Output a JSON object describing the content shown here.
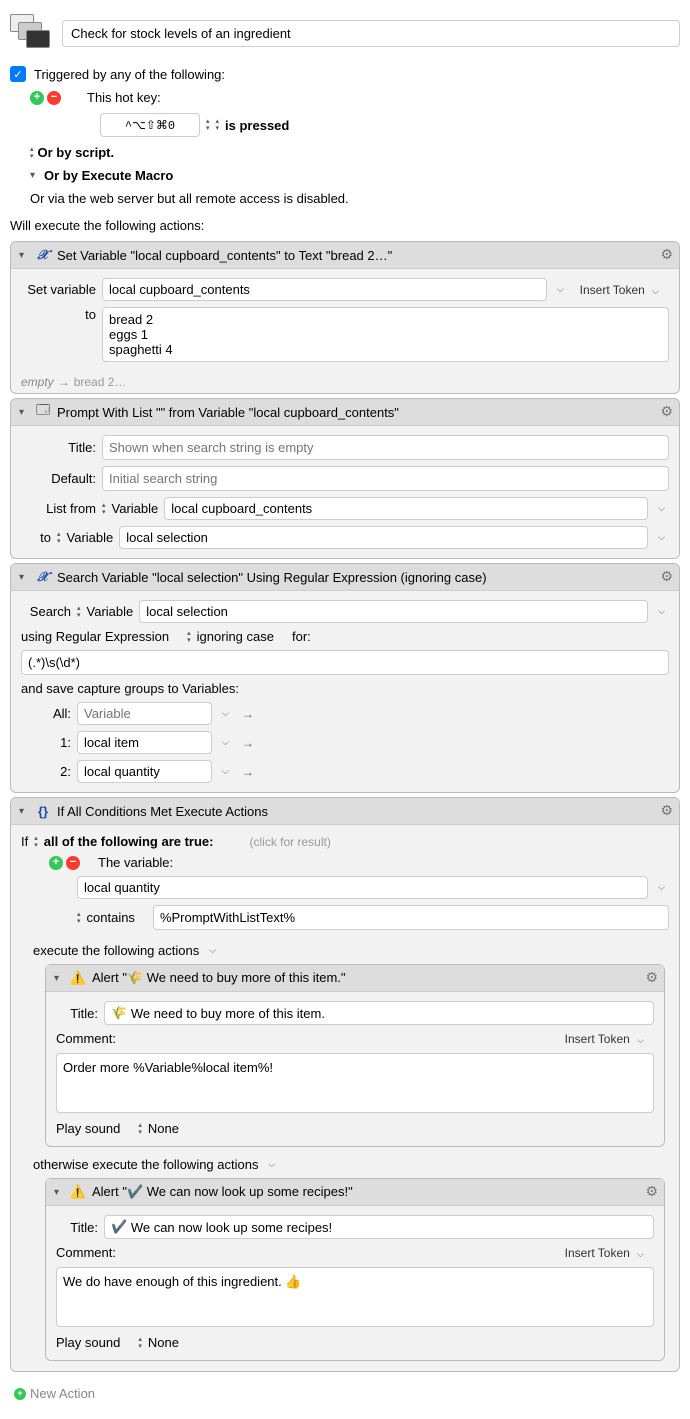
{
  "macro_title": "Check for stock levels of an ingredient",
  "triggered_by_label": "Triggered by any of the following:",
  "hotkey": {
    "label": "This hot key:",
    "value": "^⌥⇧⌘0",
    "state": "is pressed"
  },
  "or_by_script": "Or by script.",
  "or_by_execute_macro": "Or by Execute Macro",
  "or_via_web": "Or via the web server but all remote access is disabled.",
  "will_execute_label": "Will execute the following actions:",
  "action1": {
    "title": "Set Variable \"local cupboard_contents\" to Text \"bread 2…\"",
    "set_variable_label": "Set variable",
    "variable_name": "local cupboard_contents",
    "to_label": "to",
    "text_value": "bread 2\neggs 1\nspaghetti 4",
    "insert_token": "Insert Token",
    "footer_empty": "empty",
    "footer_val": "bread 2…"
  },
  "action2": {
    "title": "Prompt With List \"\" from Variable \"local cupboard_contents\"",
    "title_label": "Title:",
    "title_placeholder": "Shown when search string is empty",
    "default_label": "Default:",
    "default_placeholder": "Initial search string",
    "list_from_label": "List from",
    "variable_token": "Variable",
    "list_from_var": "local cupboard_contents",
    "to_label": "to",
    "to_var": "local selection"
  },
  "action3": {
    "title": "Search Variable \"local selection\" Using Regular Expression (ignoring case)",
    "search_label": "Search",
    "variable_token": "Variable",
    "search_var": "local selection",
    "using_regex_label": "using Regular Expression",
    "ignoring_case": "ignoring case",
    "for_label": "for:",
    "regex_value": "(.*)\\s(\\d*)",
    "save_groups_label": "and save capture groups to Variables:",
    "all_label": "All:",
    "all_placeholder": "Variable",
    "cg1_label": "1:",
    "cg1_value": "local item",
    "cg2_label": "2:",
    "cg2_value": "local quantity"
  },
  "action4": {
    "title": "If All Conditions Met Execute Actions",
    "if_label": "If",
    "all_true": "all of the following are true:",
    "click_result": "(click for result)",
    "the_variable": "The variable:",
    "var_name": "local quantity",
    "contains": "contains",
    "contains_value": "%PromptWithListText%",
    "execute_label": "execute the following actions",
    "otherwise_label": "otherwise execute the following actions",
    "alert1": {
      "header": "Alert \"🌾  We need to buy more of this item.\"",
      "title_label": "Title:",
      "title_icon": "🌾",
      "title_value": "We need to buy more of this item.",
      "comment_label": "Comment:",
      "insert_token": "Insert Token",
      "comment_value": "Order more %Variable%local item%!",
      "play_label": "Play sound",
      "sound_value": "None"
    },
    "alert2": {
      "header": "Alert \"✔️  We can now look up some recipes!\"",
      "title_label": "Title:",
      "title_icon": "✔️",
      "title_value": "We can now look up some recipes!",
      "comment_label": "Comment:",
      "insert_token": "Insert Token",
      "comment_value": "We do have enough of this ingredient. 👍",
      "play_label": "Play sound",
      "sound_value": "None"
    }
  },
  "new_action_label": "New Action"
}
